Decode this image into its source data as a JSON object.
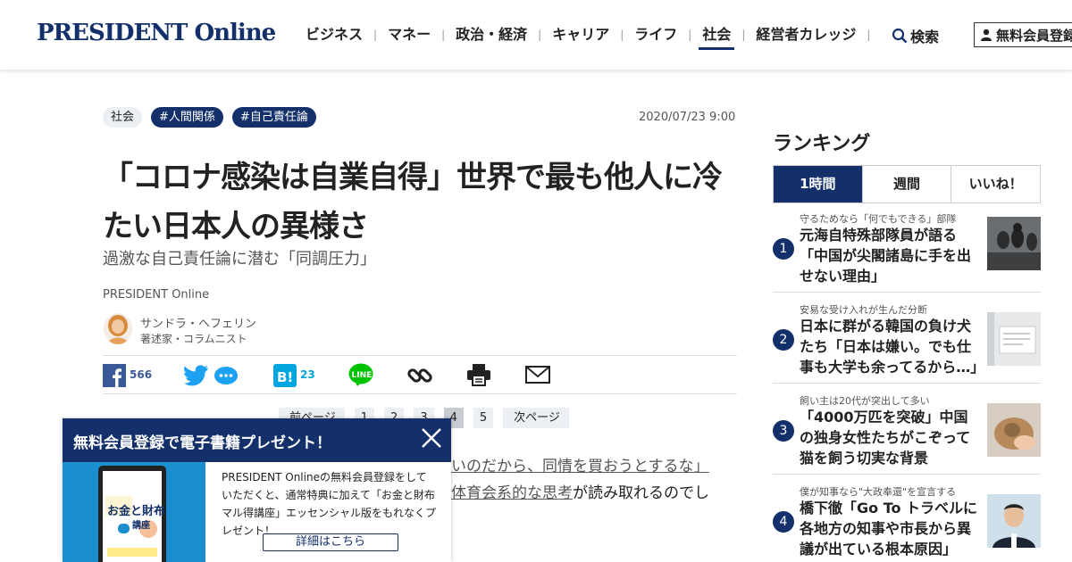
{
  "header": {
    "logo": "PRESIDENT Online",
    "nav": [
      "ビジネス",
      "マネー",
      "政治・経済",
      "キャリア",
      "ライフ",
      "社会",
      "経営者カレッジ"
    ],
    "nav_active": "社会",
    "search_label": "検索",
    "register_label": "無料会員登録"
  },
  "article": {
    "tags": [
      "社会",
      "#人間関係",
      "#自己責任論"
    ],
    "date": "2020/07/23 9:00",
    "title": "「コロナ感染は自業自得」世界で最も他人に冷たい日本人の異様さ",
    "subtitle": "過激な自己責任論に潜む「同調圧力」",
    "source": "PRESIDENT Online",
    "author_name": "サンドラ・ヘフェリン",
    "author_role": "著述家・コラムニスト",
    "share": {
      "facebook_count": "566",
      "hatena_count": "23"
    },
    "pager": {
      "prev": "前ページ",
      "pages": [
        "1",
        "2",
        "3",
        "4",
        "5"
      ],
      "current": "4",
      "next": "次ページ"
    },
    "body_line1_underlined": "いのだから、同情を買おうとするな」",
    "body_line2_underlined": "体育会系的な思考",
    "body_line2_rest": "が読み取れるのでし"
  },
  "promo": {
    "title": "無料会員登録で電子書籍プレゼント！",
    "text": "PRESIDENT Onlineの無料会員登録をしていただくと、通常特典に加えて「お金と財布マル得講座」エッセンシャル版をもれなくプレゼント！",
    "button": "詳細はこちら",
    "book_title": "お金と財布",
    "book_sub": "講座",
    "book_badge": "マル得"
  },
  "ranking": {
    "title": "ランキング",
    "tabs": [
      "1時間",
      "週間",
      "いいね！"
    ],
    "active_tab": "1時間",
    "items": [
      {
        "num": "1",
        "kicker": "守るためなら「何でもできる」部隊",
        "headline": "元海自特殊部隊員が語る「中国が尖閣諸島に手を出せない理由」"
      },
      {
        "num": "2",
        "kicker": "安易な受け入れが生んだ分断",
        "headline": "日本に群がる韓国の負け犬たち「日本は嫌い。でも仕事も大学も余ってるから…」"
      },
      {
        "num": "3",
        "kicker": "飼い主は20代が突出して多い",
        "headline": "「4000万匹を突破」中国の独身女性たちがこぞって猫を飼う切実な背景"
      },
      {
        "num": "4",
        "kicker": "僕が知事なら\"大政奉還\"を宣言する",
        "headline": "橋下徹「Go To トラベルに各地方の知事や市長から異議が出ている根本原因」"
      }
    ]
  },
  "colors": {
    "brand": "#13306b",
    "tag_light": "#eceff3"
  }
}
